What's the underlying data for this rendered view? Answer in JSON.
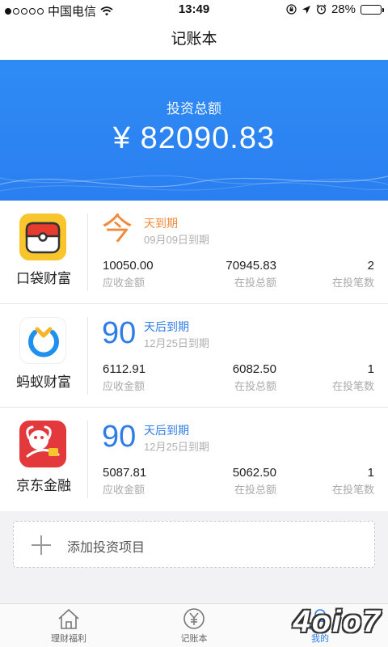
{
  "status_bar": {
    "carrier": "中国电信",
    "time": "13:49",
    "battery": "28%",
    "battery_level": 0.28,
    "icons": [
      "signal-dots-icon",
      "wifi-icon",
      "rotation-lock-icon",
      "location-arrow-icon",
      "alarm-icon",
      "battery-icon"
    ]
  },
  "nav": {
    "title": "记账本"
  },
  "hero": {
    "label": "投资总额",
    "amount": "¥ 82090.83"
  },
  "platforms": [
    {
      "name": "口袋财富",
      "logo": "koudai-pokeball-logo",
      "due_num": "今",
      "due_title": "天到期",
      "due_date": "09月09日到期",
      "due_color": "#f08a3c",
      "receivable": "10050.00",
      "receivable_label": "应收金额",
      "invested": "70945.83",
      "invested_label": "在投总额",
      "count": "2",
      "count_label": "在投笔数"
    },
    {
      "name": "蚂蚁财富",
      "logo": "ant-fortune-logo",
      "due_num": "90",
      "due_title": "天后到期",
      "due_date": "12月25日到期",
      "due_color": "#2d7ce8",
      "receivable": "6112.91",
      "receivable_label": "应收金额",
      "invested": "6082.50",
      "invested_label": "在投总额",
      "count": "1",
      "count_label": "在投笔数"
    },
    {
      "name": "京东金融",
      "logo": "jd-finance-logo",
      "due_num": "90",
      "due_title": "天后到期",
      "due_date": "12月25日到期",
      "due_color": "#2d7ce8",
      "receivable": "5087.81",
      "receivable_label": "应收金额",
      "invested": "5062.50",
      "invested_label": "在投总额",
      "count": "1",
      "count_label": "在投笔数"
    }
  ],
  "add_item": {
    "label": "添加投资项目"
  },
  "tabs": [
    {
      "label": "理财福利",
      "icon": "home-icon"
    },
    {
      "label": "记账本",
      "icon": "yen-circle-icon"
    },
    {
      "label": "我的",
      "icon": "user-icon",
      "active": true
    }
  ],
  "watermark": "4oio7",
  "colors": {
    "accent": "#2d7ce8",
    "hero": "#2f8bf4",
    "due_today": "#f08a3c"
  }
}
